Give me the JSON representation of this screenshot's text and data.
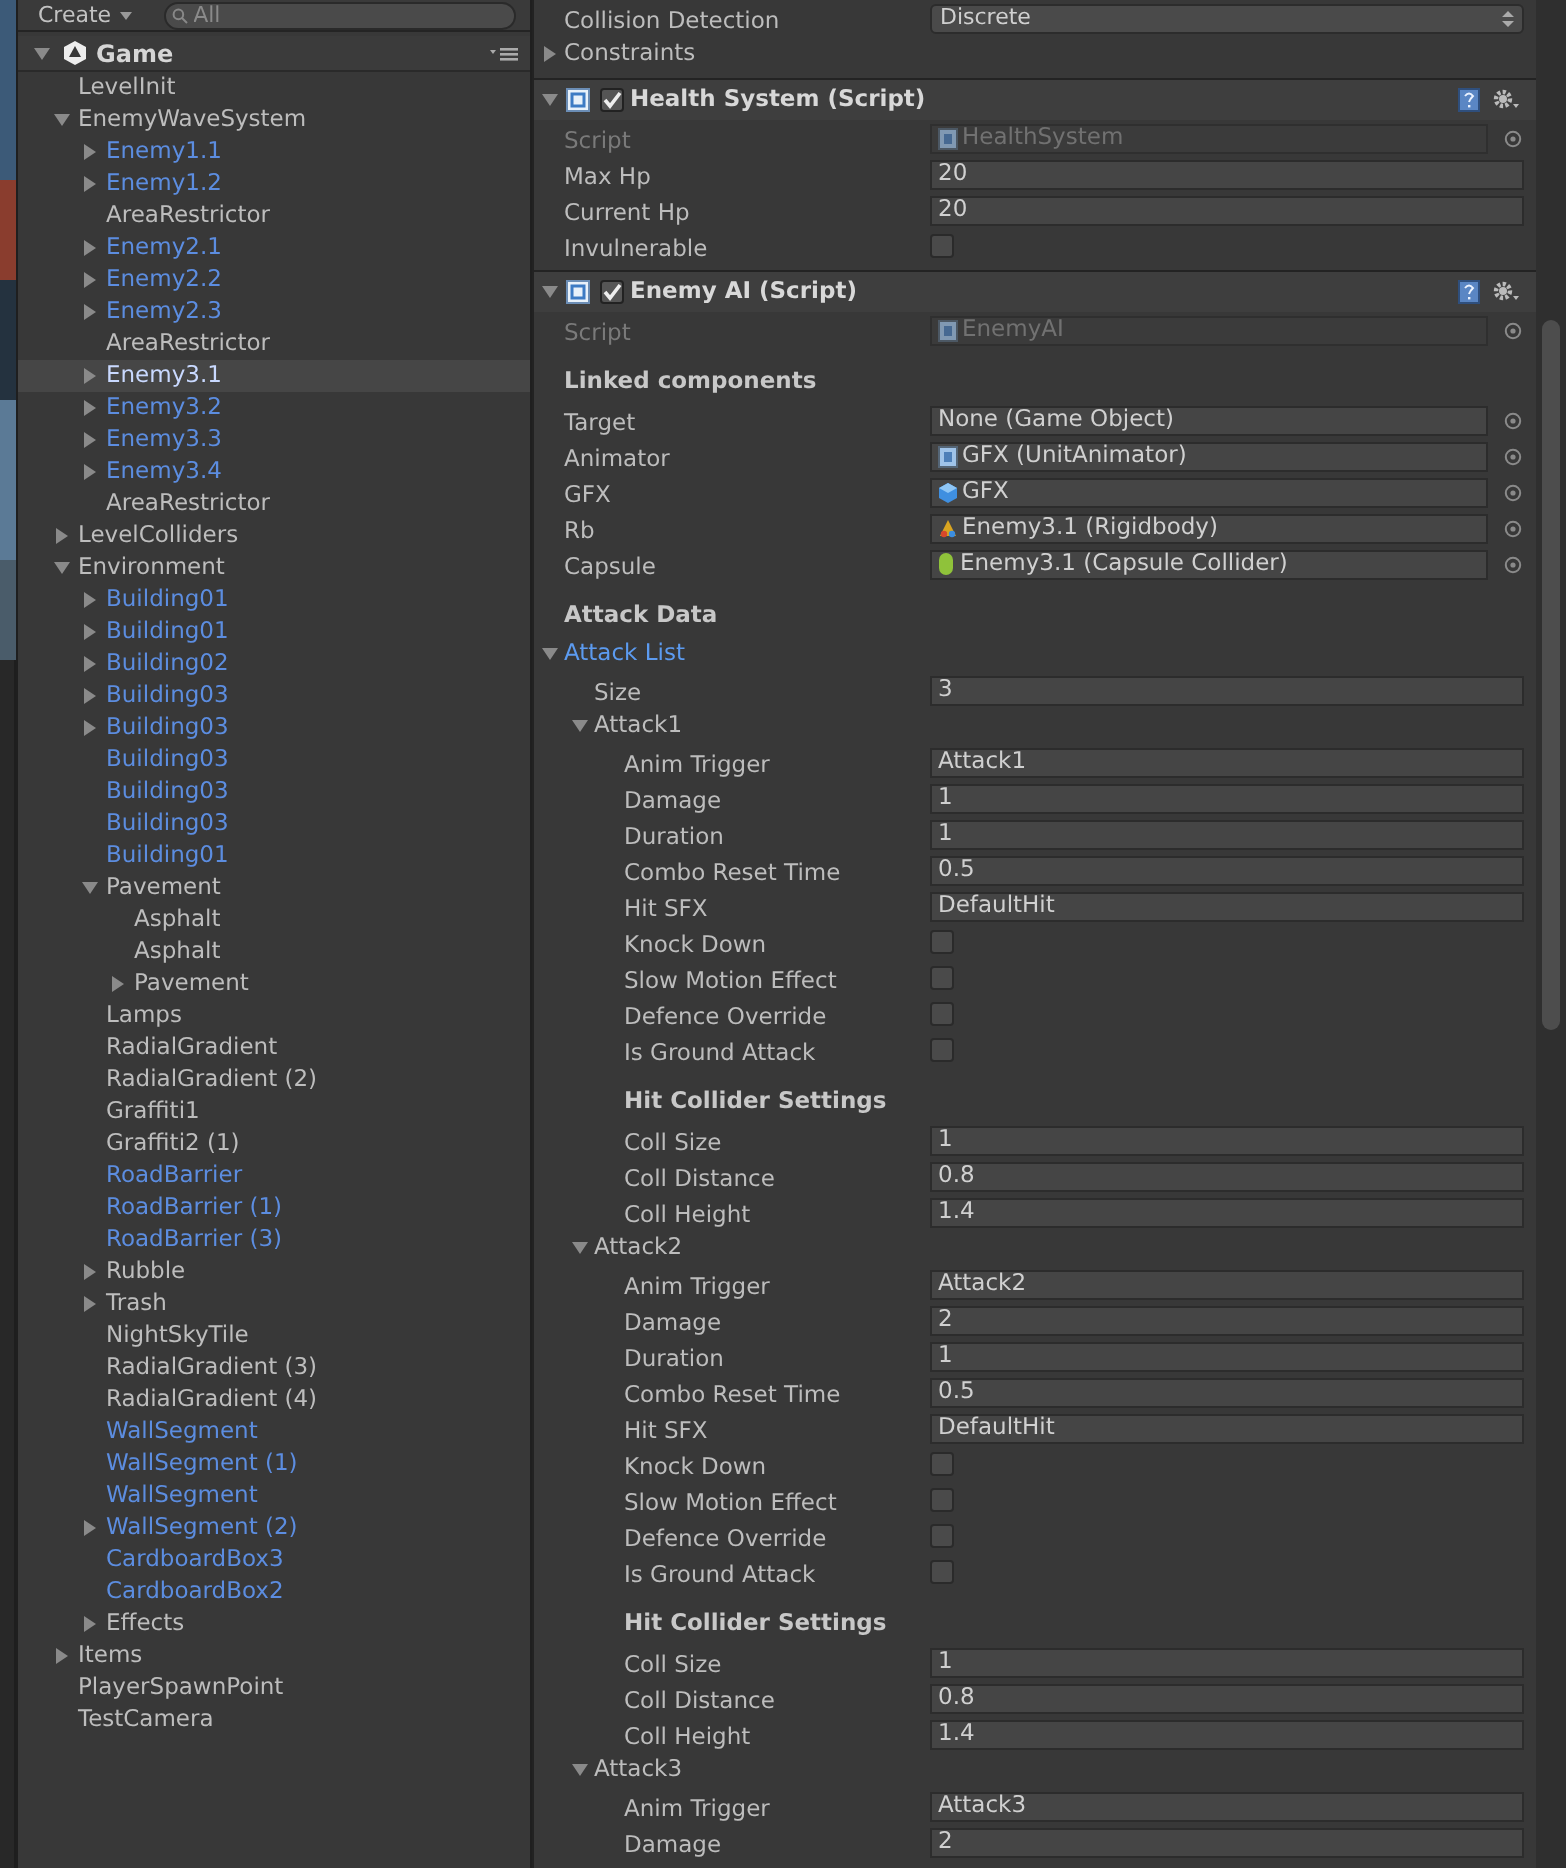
{
  "toolbar": {
    "create_label": "Create",
    "search_placeholder": "All"
  },
  "hierarchy": {
    "title": "Game",
    "expanded": true,
    "items": [
      {
        "name": "LevelInit",
        "kind": "leaf",
        "prefab": false,
        "selected": false
      },
      {
        "name": "EnemyWaveSystem",
        "kind": "group",
        "expanded": true,
        "prefab": false,
        "selected": false,
        "children": [
          {
            "name": "Enemy1.1",
            "kind": "group",
            "expanded": false,
            "prefab": true,
            "selected": false
          },
          {
            "name": "Enemy1.2",
            "kind": "group",
            "expanded": false,
            "prefab": true,
            "selected": false
          },
          {
            "name": "AreaRestrictor",
            "kind": "leaf",
            "prefab": false,
            "selected": false
          },
          {
            "name": "Enemy2.1",
            "kind": "group",
            "expanded": false,
            "prefab": true,
            "selected": false
          },
          {
            "name": "Enemy2.2",
            "kind": "group",
            "expanded": false,
            "prefab": true,
            "selected": false
          },
          {
            "name": "Enemy2.3",
            "kind": "group",
            "expanded": false,
            "prefab": true,
            "selected": false
          },
          {
            "name": "AreaRestrictor",
            "kind": "leaf",
            "prefab": false,
            "selected": false
          },
          {
            "name": "Enemy3.1",
            "kind": "group",
            "expanded": false,
            "prefab": true,
            "selected": true
          },
          {
            "name": "Enemy3.2",
            "kind": "group",
            "expanded": false,
            "prefab": true,
            "selected": false
          },
          {
            "name": "Enemy3.3",
            "kind": "group",
            "expanded": false,
            "prefab": true,
            "selected": false
          },
          {
            "name": "Enemy3.4",
            "kind": "group",
            "expanded": false,
            "prefab": true,
            "selected": false
          },
          {
            "name": "AreaRestrictor",
            "kind": "leaf",
            "prefab": false,
            "selected": false
          }
        ]
      },
      {
        "name": "LevelColliders",
        "kind": "group",
        "expanded": false,
        "prefab": false,
        "selected": false
      },
      {
        "name": "Environment",
        "kind": "group",
        "expanded": true,
        "prefab": false,
        "selected": false,
        "children": [
          {
            "name": "Building01",
            "kind": "group",
            "expanded": false,
            "prefab": true,
            "selected": false
          },
          {
            "name": "Building01",
            "kind": "group",
            "expanded": false,
            "prefab": true,
            "selected": false
          },
          {
            "name": "Building02",
            "kind": "group",
            "expanded": false,
            "prefab": true,
            "selected": false
          },
          {
            "name": "Building03",
            "kind": "group",
            "expanded": false,
            "prefab": true,
            "selected": false
          },
          {
            "name": "Building03",
            "kind": "group",
            "expanded": false,
            "prefab": true,
            "selected": false
          },
          {
            "name": "Building03",
            "kind": "leaf",
            "prefab": true,
            "selected": false
          },
          {
            "name": "Building03",
            "kind": "leaf",
            "prefab": true,
            "selected": false
          },
          {
            "name": "Building03",
            "kind": "leaf",
            "prefab": true,
            "selected": false
          },
          {
            "name": "Building01",
            "kind": "leaf",
            "prefab": true,
            "selected": false
          },
          {
            "name": "Pavement",
            "kind": "group",
            "expanded": true,
            "prefab": false,
            "selected": false,
            "children": [
              {
                "name": "Asphalt",
                "kind": "leaf",
                "prefab": false,
                "selected": false
              },
              {
                "name": "Asphalt",
                "kind": "leaf",
                "prefab": false,
                "selected": false
              },
              {
                "name": "Pavement",
                "kind": "group",
                "expanded": false,
                "prefab": false,
                "selected": false
              }
            ]
          },
          {
            "name": "Lamps",
            "kind": "leaf",
            "prefab": false,
            "selected": false
          },
          {
            "name": "RadialGradient",
            "kind": "leaf",
            "prefab": false,
            "selected": false
          },
          {
            "name": "RadialGradient (2)",
            "kind": "leaf",
            "prefab": false,
            "selected": false
          },
          {
            "name": "Graffiti1",
            "kind": "leaf",
            "prefab": false,
            "selected": false
          },
          {
            "name": "Graffiti2 (1)",
            "kind": "leaf",
            "prefab": false,
            "selected": false
          },
          {
            "name": "RoadBarrier",
            "kind": "leaf",
            "prefab": true,
            "selected": false
          },
          {
            "name": "RoadBarrier (1)",
            "kind": "leaf",
            "prefab": true,
            "selected": false
          },
          {
            "name": "RoadBarrier (3)",
            "kind": "leaf",
            "prefab": true,
            "selected": false
          },
          {
            "name": "Rubble",
            "kind": "group",
            "expanded": false,
            "prefab": false,
            "selected": false
          },
          {
            "name": "Trash",
            "kind": "group",
            "expanded": false,
            "prefab": false,
            "selected": false
          },
          {
            "name": "NightSkyTile",
            "kind": "leaf",
            "prefab": false,
            "selected": false
          },
          {
            "name": "RadialGradient (3)",
            "kind": "leaf",
            "prefab": false,
            "selected": false
          },
          {
            "name": "RadialGradient (4)",
            "kind": "leaf",
            "prefab": false,
            "selected": false
          },
          {
            "name": "WallSegment",
            "kind": "leaf",
            "prefab": true,
            "selected": false
          },
          {
            "name": "WallSegment (1)",
            "kind": "leaf",
            "prefab": true,
            "selected": false
          },
          {
            "name": "WallSegment",
            "kind": "leaf",
            "prefab": true,
            "selected": false
          },
          {
            "name": "WallSegment (2)",
            "kind": "group",
            "expanded": false,
            "prefab": true,
            "selected": false
          },
          {
            "name": "CardboardBox3",
            "kind": "leaf",
            "prefab": true,
            "selected": false
          },
          {
            "name": "CardboardBox2",
            "kind": "leaf",
            "prefab": true,
            "selected": false
          },
          {
            "name": "Effects",
            "kind": "group",
            "expanded": false,
            "prefab": false,
            "selected": false
          }
        ]
      },
      {
        "name": "Items",
        "kind": "group",
        "expanded": false,
        "prefab": false,
        "selected": false
      },
      {
        "name": "PlayerSpawnPoint",
        "kind": "leaf",
        "prefab": false,
        "selected": false
      },
      {
        "name": "TestCamera",
        "kind": "leaf",
        "prefab": false,
        "selected": false
      }
    ]
  },
  "inspector": {
    "top_fields": [
      {
        "kind": "dropdown",
        "label": "Collision Detection",
        "value": "Discrete"
      },
      {
        "kind": "foldout",
        "label": "Constraints",
        "expanded": false,
        "selected": false
      }
    ],
    "components": [
      {
        "title": "Health System (Script)",
        "expanded": true,
        "enabled": true,
        "fields": [
          {
            "kind": "script",
            "label": "Script",
            "value": "HealthSystem",
            "disabled": true
          },
          {
            "kind": "text",
            "label": "Max Hp",
            "value": "20"
          },
          {
            "kind": "text",
            "label": "Current Hp",
            "value": "20"
          },
          {
            "kind": "checkbox",
            "label": "Invulnerable",
            "checked": false
          }
        ]
      },
      {
        "title": "Enemy AI (Script)",
        "expanded": true,
        "enabled": true,
        "fields": [
          {
            "kind": "script",
            "label": "Script",
            "value": "EnemyAI",
            "disabled": true
          },
          {
            "kind": "header",
            "label": "Linked components"
          },
          {
            "kind": "object",
            "label": "Target",
            "value": "None (Game Object)",
            "disabled": false
          },
          {
            "kind": "script",
            "label": "Animator",
            "value": "GFX (UnitAnimator)",
            "disabled": false
          },
          {
            "kind": "gameobject",
            "label": "GFX",
            "value": "GFX",
            "disabled": false
          },
          {
            "kind": "rigidbody",
            "label": "Rb",
            "value": "Enemy3.1 (Rigidbody)",
            "disabled": false
          },
          {
            "kind": "collider",
            "label": "Capsule",
            "value": "Enemy3.1 (Capsule Collider)",
            "disabled": false
          },
          {
            "kind": "header",
            "label": "Attack Data"
          },
          {
            "kind": "foldout",
            "label": "Attack List",
            "expanded": true,
            "selected": true,
            "children": [
              {
                "kind": "text",
                "label": "Size",
                "value": "3"
              },
              {
                "kind": "foldout",
                "label": "Attack1",
                "expanded": true,
                "selected": false,
                "children": [
                  {
                    "kind": "text",
                    "label": "Anim Trigger",
                    "value": "Attack1"
                  },
                  {
                    "kind": "text",
                    "label": "Damage",
                    "value": "1"
                  },
                  {
                    "kind": "text",
                    "label": "Duration",
                    "value": "1"
                  },
                  {
                    "kind": "text",
                    "label": "Combo Reset Time",
                    "value": "0.5"
                  },
                  {
                    "kind": "text",
                    "label": "Hit SFX",
                    "value": "DefaultHit"
                  },
                  {
                    "kind": "checkbox",
                    "label": "Knock Down",
                    "checked": false
                  },
                  {
                    "kind": "checkbox",
                    "label": "Slow Motion Effect",
                    "checked": false
                  },
                  {
                    "kind": "checkbox",
                    "label": "Defence Override",
                    "checked": false
                  },
                  {
                    "kind": "checkbox",
                    "label": "Is Ground Attack",
                    "checked": false
                  },
                  {
                    "kind": "header",
                    "label": "Hit Collider Settings"
                  },
                  {
                    "kind": "text",
                    "label": "Coll Size",
                    "value": "1"
                  },
                  {
                    "kind": "text",
                    "label": "Coll Distance",
                    "value": "0.8"
                  },
                  {
                    "kind": "text",
                    "label": "Coll Height",
                    "value": "1.4"
                  }
                ]
              },
              {
                "kind": "foldout",
                "label": "Attack2",
                "expanded": true,
                "selected": false,
                "children": [
                  {
                    "kind": "text",
                    "label": "Anim Trigger",
                    "value": "Attack2"
                  },
                  {
                    "kind": "text",
                    "label": "Damage",
                    "value": "2"
                  },
                  {
                    "kind": "text",
                    "label": "Duration",
                    "value": "1"
                  },
                  {
                    "kind": "text",
                    "label": "Combo Reset Time",
                    "value": "0.5"
                  },
                  {
                    "kind": "text",
                    "label": "Hit SFX",
                    "value": "DefaultHit"
                  },
                  {
                    "kind": "checkbox",
                    "label": "Knock Down",
                    "checked": false
                  },
                  {
                    "kind": "checkbox",
                    "label": "Slow Motion Effect",
                    "checked": false
                  },
                  {
                    "kind": "checkbox",
                    "label": "Defence Override",
                    "checked": false
                  },
                  {
                    "kind": "checkbox",
                    "label": "Is Ground Attack",
                    "checked": false
                  },
                  {
                    "kind": "header",
                    "label": "Hit Collider Settings"
                  },
                  {
                    "kind": "text",
                    "label": "Coll Size",
                    "value": "1"
                  },
                  {
                    "kind": "text",
                    "label": "Coll Distance",
                    "value": "0.8"
                  },
                  {
                    "kind": "text",
                    "label": "Coll Height",
                    "value": "1.4"
                  }
                ]
              },
              {
                "kind": "foldout",
                "label": "Attack3",
                "expanded": true,
                "selected": false,
                "children": [
                  {
                    "kind": "text",
                    "label": "Anim Trigger",
                    "value": "Attack3"
                  },
                  {
                    "kind": "text",
                    "label": "Damage",
                    "value": "2"
                  }
                ]
              }
            ]
          }
        ]
      }
    ]
  }
}
